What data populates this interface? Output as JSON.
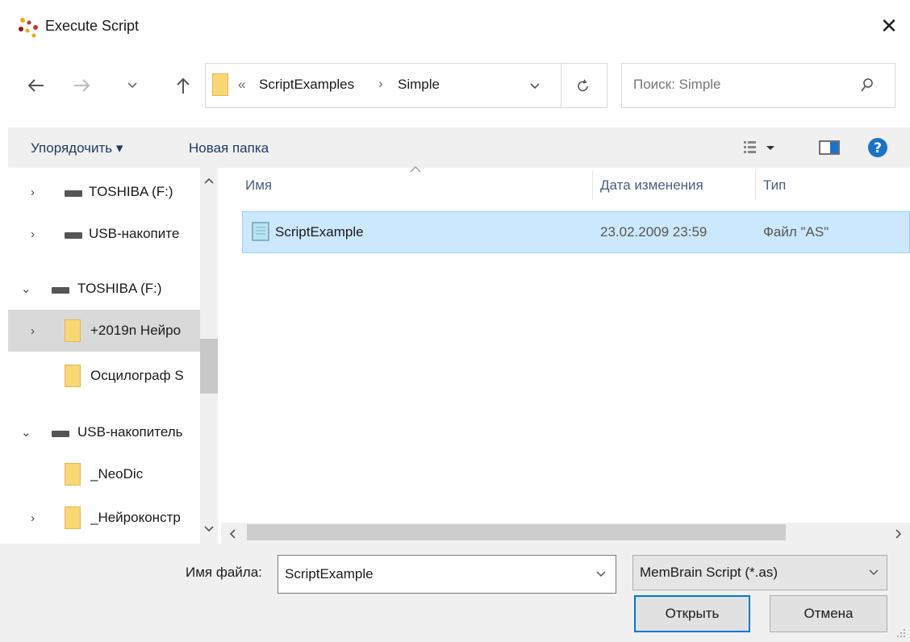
{
  "window": {
    "title": "Execute Script",
    "close_glyph": "✕"
  },
  "nav": {
    "back_icon": "arrow-left-icon",
    "forward_icon": "arrow-right-icon",
    "recent_icon": "chevron-down-icon",
    "up_icon": "arrow-up-icon",
    "path_overflow": "«",
    "path": [
      "ScriptExamples",
      "Simple"
    ],
    "path_separator": "›",
    "search_placeholder": "Поиск: Simple"
  },
  "toolbar": {
    "organize_label": "Упорядочить ▾",
    "new_folder_label": "Новая папка"
  },
  "sidebar": {
    "items": [
      {
        "label": "TOSHIBA (F:)",
        "kind": "drive",
        "expander": "›"
      },
      {
        "label": "USB-накопите",
        "kind": "drive",
        "expander": "›"
      },
      {
        "label": "TOSHIBA (F:)",
        "kind": "drive",
        "expander": "⌄"
      },
      {
        "label": "+2019n Нейро",
        "kind": "folder",
        "expander": "›",
        "selected": true
      },
      {
        "label": "Осцилограф S",
        "kind": "folder",
        "expander": ""
      },
      {
        "label": "USB-накопитель",
        "kind": "drive",
        "expander": "⌄"
      },
      {
        "label": "_NeoDic",
        "kind": "folder",
        "expander": ""
      },
      {
        "label": "_Нейроконстр",
        "kind": "folder",
        "expander": "›"
      }
    ]
  },
  "filelist": {
    "columns": {
      "name": "Имя",
      "date": "Дата изменения",
      "type": "Тип"
    },
    "rows": [
      {
        "name": "ScriptExample",
        "date": "23.02.2009 23:59",
        "type": "Файл \"AS\""
      }
    ]
  },
  "bottom": {
    "filename_label": "Имя файла:",
    "filename_value": "ScriptExample",
    "filetype_value": "MemBrain Script (*.as)",
    "open_label": "Открыть",
    "cancel_label": "Отмена"
  },
  "colors": {
    "accent": "#0078d7",
    "selection": "#cce8ff",
    "help": "#1a73c7"
  }
}
